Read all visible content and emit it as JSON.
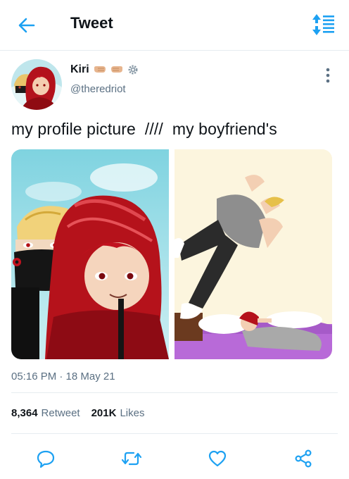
{
  "header": {
    "title": "Tweet",
    "back_icon": "arrow-left-icon",
    "sort_icon": "sort-icon",
    "accent": "#1da1f2"
  },
  "tweet": {
    "author": {
      "display_name": "Kiri",
      "name_emojis": [
        "fist-bump-emoji",
        "fist-bump-emoji",
        "gear-emoji"
      ],
      "handle": "@theredriot"
    },
    "text": "my profile picture  ////  my boyfriend's",
    "media": [
      {
        "name": "profile-picture-art",
        "description_icon": "illustration"
      },
      {
        "name": "boyfriend-art",
        "description_icon": "illustration"
      }
    ],
    "timestamp": "05:16 PM · 18 May 21",
    "stats": {
      "retweets_count": "8,364",
      "retweets_label": "Retweet",
      "likes_count": "201K",
      "likes_label": "Likes"
    },
    "actions": [
      {
        "name": "reply",
        "icon": "comment-icon"
      },
      {
        "name": "retweet",
        "icon": "retweet-icon"
      },
      {
        "name": "like",
        "icon": "heart-icon"
      },
      {
        "name": "share",
        "icon": "share-icon"
      }
    ]
  },
  "colors": {
    "text_primary": "#0f1419",
    "text_secondary": "#5b7083",
    "divider": "#e6ecf0",
    "action_icon": "#1da1f2"
  }
}
